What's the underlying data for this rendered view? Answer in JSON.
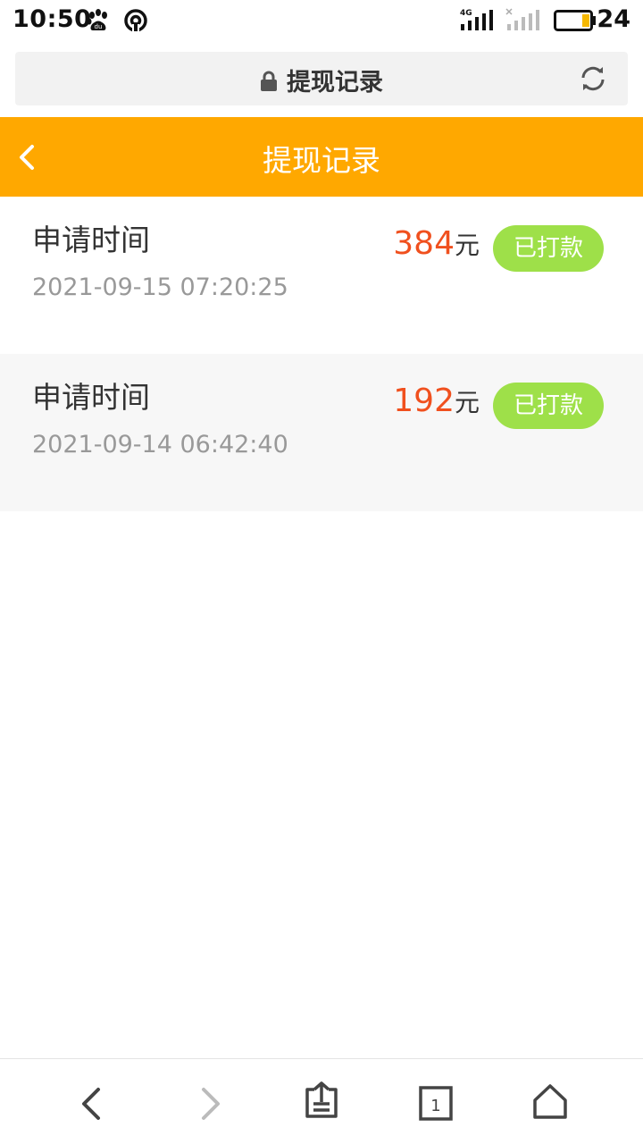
{
  "status_bar": {
    "time": "10:50",
    "network_type": "4G",
    "battery_level": "24",
    "icons": [
      "baidu-paw-icon",
      "hotspot-icon",
      "signal-4g-icon",
      "signal-empty-icon",
      "battery-icon"
    ]
  },
  "address_bar": {
    "title": "提现记录",
    "icons": [
      "lock-icon",
      "refresh-icon"
    ]
  },
  "header": {
    "title": "提现记录",
    "background_color": "#ffa800",
    "icons": [
      "back-chevron-icon"
    ]
  },
  "records": [
    {
      "label": "申请时间",
      "time": "2021-09-15 07:20:25",
      "amount": "384",
      "unit": "元",
      "status": "已打款"
    },
    {
      "label": "申请时间",
      "time": "2021-09-14 06:42:40",
      "amount": "192",
      "unit": "元",
      "status": "已打款"
    }
  ],
  "colors": {
    "amount": "#f0501e",
    "status_badge": "#9ee049",
    "accent": "#ffa800"
  },
  "toolbar": {
    "tab_count": "1",
    "icons": [
      "back-icon",
      "forward-icon",
      "share-icon",
      "tabs-icon",
      "home-icon"
    ]
  }
}
